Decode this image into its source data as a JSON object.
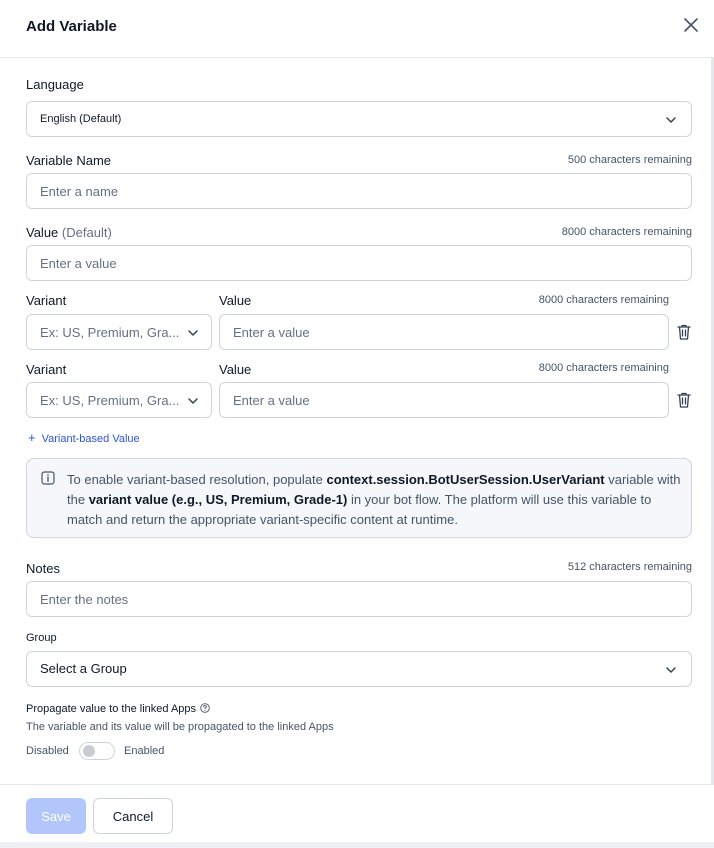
{
  "dialog": {
    "title": "Add Variable"
  },
  "language": {
    "label": "Language",
    "value": "English (Default)"
  },
  "variable_name": {
    "label": "Variable Name",
    "remaining": "500 characters remaining",
    "placeholder": "Enter a name"
  },
  "value": {
    "label": "Value",
    "label_suffix": "(Default)",
    "remaining": "8000 characters remaining",
    "placeholder": "Enter a value"
  },
  "variants": [
    {
      "variant_label": "Variant",
      "variant_placeholder": "Ex: US, Premium, Gra...",
      "value_label": "Value",
      "remaining": "8000 characters remaining",
      "value_placeholder": "Enter a value"
    },
    {
      "variant_label": "Variant",
      "variant_placeholder": "Ex: US, Premium, Gra...",
      "value_label": "Value",
      "remaining": "8000 characters remaining",
      "value_placeholder": "Enter a value"
    }
  ],
  "add_variant": {
    "label": "Variant-based Value"
  },
  "info": {
    "part1": "To enable variant-based resolution, populate ",
    "bold1": "context.session.BotUserSession.UserVariant",
    "part2": " variable with the ",
    "bold2": "variant value (e.g., US, Premium, Grade-1)",
    "part3": " in your bot flow. The platform will use this variable to match and return the appropriate variant-specific content at runtime."
  },
  "notes": {
    "label": "Notes",
    "remaining": "512 characters remaining",
    "placeholder": "Enter the notes"
  },
  "group": {
    "label": "Group",
    "value": "Select a Group"
  },
  "propagate": {
    "label": "Propagate value to the linked Apps",
    "description": "The variable and its value will be propagated to the linked Apps",
    "off_label": "Disabled",
    "on_label": "Enabled",
    "enabled": false
  },
  "footer": {
    "save_label": "Save",
    "cancel_label": "Cancel"
  },
  "colors": {
    "accent": "#2c55d6",
    "save_disabled": "#b3c6fb",
    "border": "#d0d5dd"
  }
}
